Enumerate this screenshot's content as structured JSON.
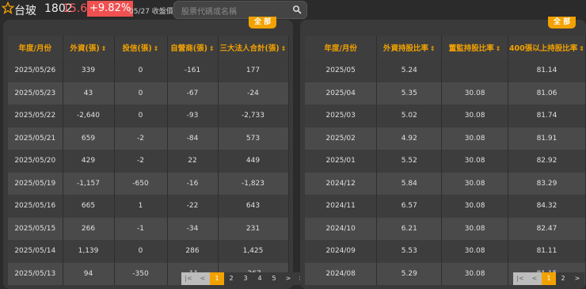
{
  "header": {
    "stock_name": "台玻",
    "stock_code": "1802",
    "price": "15.65",
    "change_pct": "+9.82%",
    "close_label": "05/27 收盤價",
    "search_placeholder": "股票代碼或名稱",
    "colors": {
      "up": "#ff5e5e",
      "accent": "#f2a200"
    }
  },
  "left_panel": {
    "all_button": "全  部",
    "columns": [
      "年度/月份",
      "外資(張)",
      "投信(張)",
      "自營商(張)",
      "三大法人合計(張)"
    ],
    "rows": [
      [
        "2025/05/26",
        "339",
        "0",
        "-161",
        "177"
      ],
      [
        "2025/05/23",
        "43",
        "0",
        "-67",
        "-24"
      ],
      [
        "2025/05/22",
        "-2,640",
        "0",
        "-93",
        "-2,733"
      ],
      [
        "2025/05/21",
        "659",
        "-2",
        "-84",
        "573"
      ],
      [
        "2025/05/20",
        "429",
        "-2",
        "22",
        "449"
      ],
      [
        "2025/05/19",
        "-1,157",
        "-650",
        "-16",
        "-1,823"
      ],
      [
        "2025/05/16",
        "665",
        "1",
        "-22",
        "643"
      ],
      [
        "2025/05/15",
        "266",
        "-1",
        "-34",
        "231"
      ],
      [
        "2025/05/14",
        "1,139",
        "0",
        "286",
        "1,425"
      ],
      [
        "2025/05/13",
        "94",
        "-350",
        "-11",
        "-267"
      ]
    ],
    "pagination": [
      "|<",
      "<",
      "1",
      "2",
      "3",
      "4",
      "5",
      ">",
      ">|"
    ],
    "active_page": "1"
  },
  "right_panel": {
    "all_button": "全  部",
    "columns": [
      "年度/月份",
      "外資持股比率",
      "董監持股比率",
      "400張以上持股比率"
    ],
    "rows": [
      [
        "2025/05",
        "5.24",
        "",
        "81.14"
      ],
      [
        "2025/04",
        "5.35",
        "30.08",
        "81.06"
      ],
      [
        "2025/03",
        "5.02",
        "30.08",
        "81.74"
      ],
      [
        "2025/02",
        "4.92",
        "30.08",
        "81.91"
      ],
      [
        "2025/01",
        "5.52",
        "30.08",
        "82.92"
      ],
      [
        "2024/12",
        "5.84",
        "30.08",
        "83.29"
      ],
      [
        "2024/11",
        "6.57",
        "30.08",
        "84.32"
      ],
      [
        "2024/10",
        "6.21",
        "30.08",
        "82.47"
      ],
      [
        "2024/09",
        "5.53",
        "30.08",
        "81.11"
      ],
      [
        "2024/08",
        "5.29",
        "30.08",
        "81.15"
      ]
    ],
    "pagination": [
      "|<",
      "<",
      "1",
      "2",
      ">"
    ],
    "active_page": "1"
  }
}
